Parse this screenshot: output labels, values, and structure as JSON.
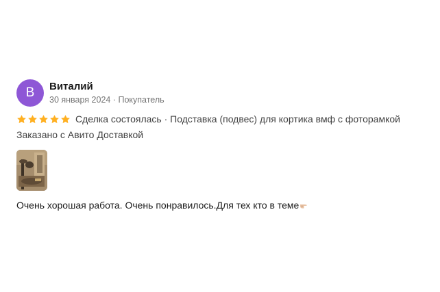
{
  "review": {
    "avatar_letter": "В",
    "avatar_color": "#8e57d6",
    "author": "Виталий",
    "date": "30 января 2024",
    "separator": " · ",
    "role": "Покупатель",
    "rating": 5,
    "star_color": "#ffb021",
    "deal_status": "Сделка состоялась",
    "item_title": "Подставка (подвес) для кортика вмф с фоторамкой",
    "delivery_note": "Заказано с Авито Доставкой",
    "photo_count": 1,
    "comment": "Очень хорошая работа. Очень понравилось.Для тех кто в теме",
    "comment_emoji": "hand-pointing-right-icon"
  }
}
